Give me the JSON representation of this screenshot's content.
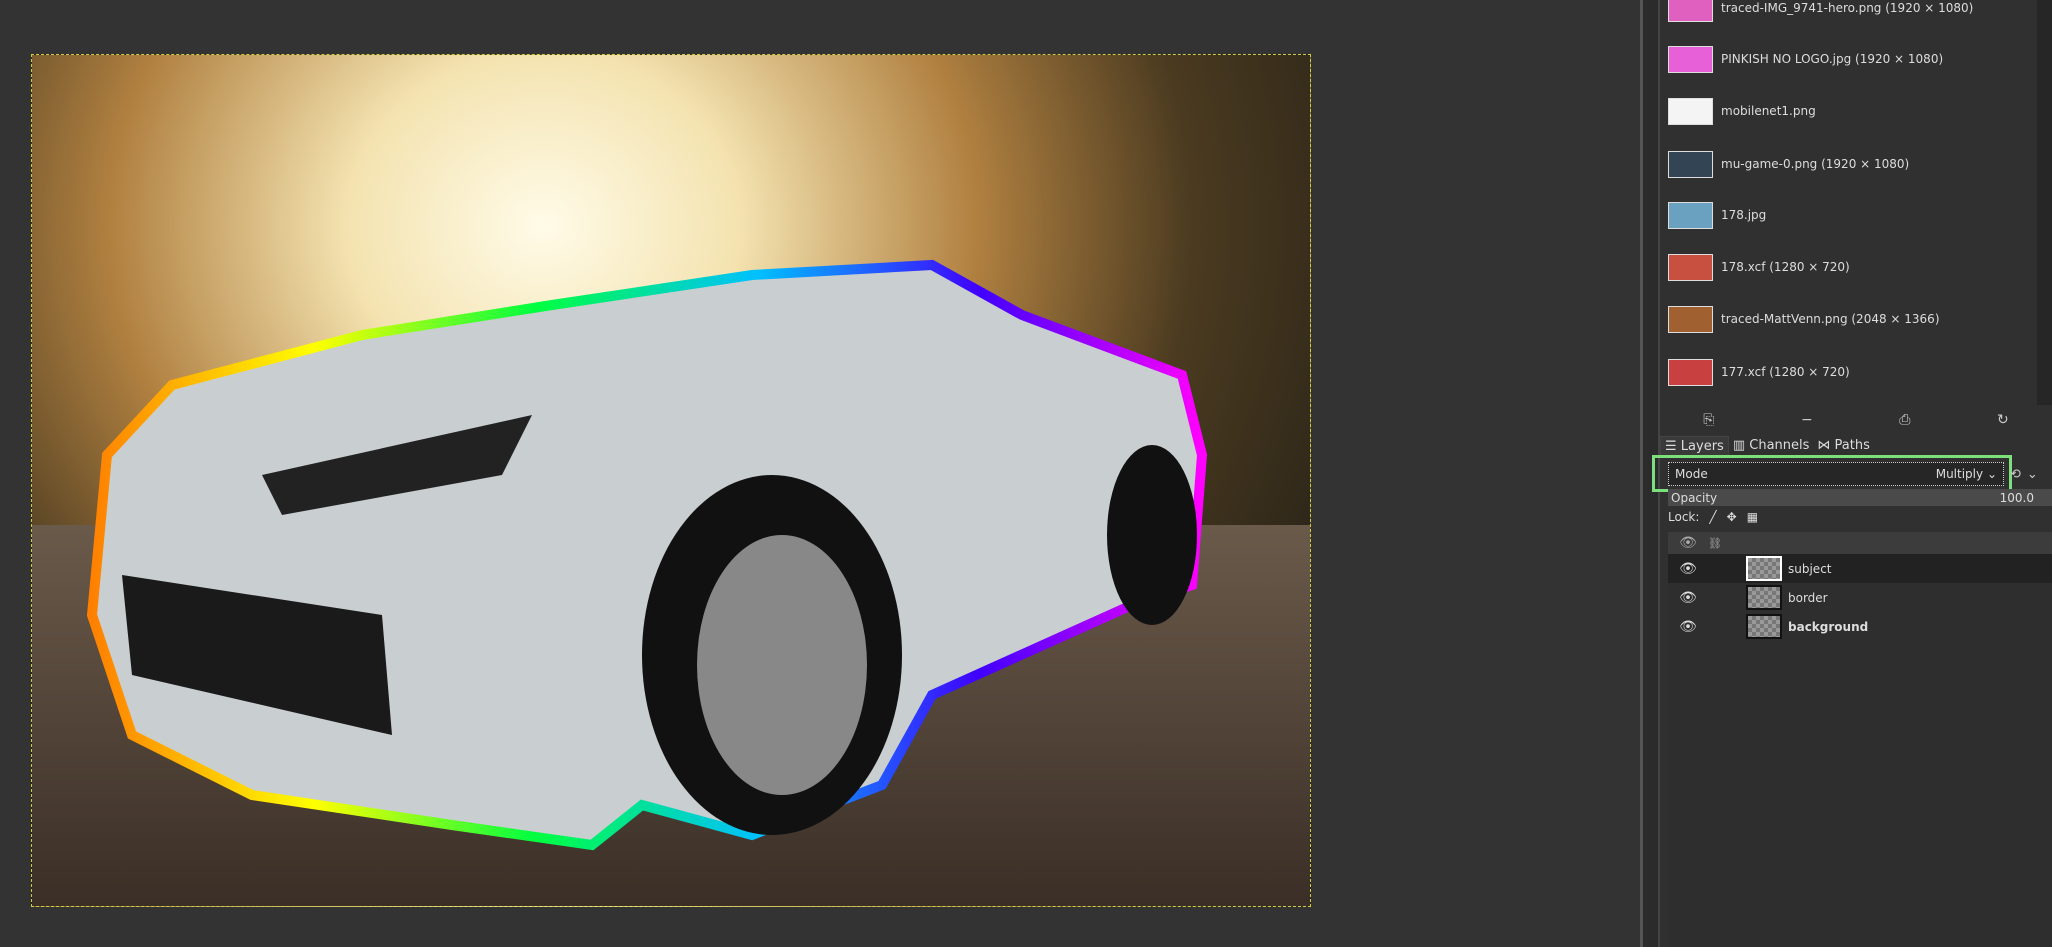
{
  "images": [
    {
      "label": "traced-IMG_9741-hero.png (1920 × 1080)",
      "thumb": "#e060c0"
    },
    {
      "label": "PINKISH NO LOGO.jpg (1920 × 1080)",
      "thumb": "#e860d8"
    },
    {
      "label": "mobilenet1.png",
      "thumb": "#f4f4f4"
    },
    {
      "label": "mu-game-0.png (1920 × 1080)",
      "thumb": "#345"
    },
    {
      "label": "178.jpg",
      "thumb": "#6aa0c0"
    },
    {
      "label": "178.xcf (1280 × 720)",
      "thumb": "#c85040"
    },
    {
      "label": "traced-MattVenn.png (2048 × 1366)",
      "thumb": "#a06030"
    },
    {
      "label": "177.xcf (1280 × 720)",
      "thumb": "#c84040"
    }
  ],
  "image_toolbar": [
    "⎘",
    "−",
    "⎙",
    "↻"
  ],
  "tabs": [
    "Layers",
    "Channels",
    "Paths"
  ],
  "mode": {
    "label": "Mode",
    "value": "Multiply"
  },
  "opacity": {
    "label": "Opacity",
    "value": "100.0"
  },
  "lock_label": "Lock:",
  "layers": [
    {
      "name": "subject",
      "selected": true,
      "bold": false
    },
    {
      "name": "border",
      "selected": false,
      "bold": false
    },
    {
      "name": "background",
      "selected": false,
      "bold": true
    }
  ],
  "colors": {
    "highlight": "#7be07b"
  }
}
